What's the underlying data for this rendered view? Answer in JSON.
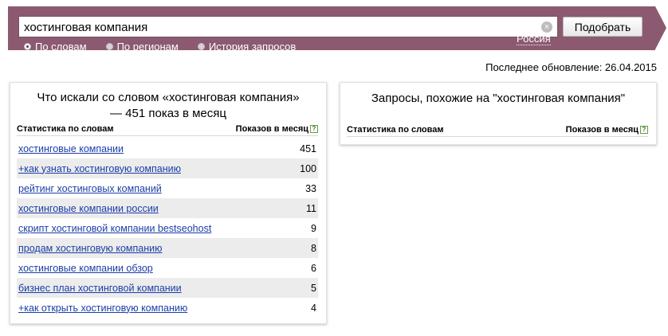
{
  "search": {
    "value": "хостинговая компания",
    "clear_glyph": "×",
    "submit_label": "Подобрать"
  },
  "modes": [
    {
      "label": "По словам",
      "checked": true
    },
    {
      "label": "По регионам",
      "checked": false
    },
    {
      "label": "История запросов",
      "checked": false
    }
  ],
  "region": "Россия",
  "last_update": "Последнее обновление: 26.04.2015",
  "left_panel": {
    "title": "Что искали со словом «хостинговая компания» — 451 показ в месяц",
    "col_words": "Статистика по словам",
    "col_impressions": "Показов в месяц",
    "help_glyph": "?",
    "rows": [
      {
        "phrase": "хостинговые компании",
        "count": "451"
      },
      {
        "phrase": "+как узнать хостинговую компанию",
        "count": "100"
      },
      {
        "phrase": "рейтинг хостинговых компаний",
        "count": "33"
      },
      {
        "phrase": "хостинговые компании россии",
        "count": "11"
      },
      {
        "phrase": "скрипт хостинговой компании bestseohost",
        "count": "9"
      },
      {
        "phrase": "продам хостинговую компанию",
        "count": "8"
      },
      {
        "phrase": "хостинговые компании обзор",
        "count": "6"
      },
      {
        "phrase": "бизнес план хостинговой компании",
        "count": "5"
      },
      {
        "phrase": "+как открыть хостинговую компанию",
        "count": "4"
      }
    ]
  },
  "right_panel": {
    "title": "Запросы, похожие на \"хостинговая компания\"",
    "col_words": "Статистика по словам",
    "col_impressions": "Показов в месяц",
    "help_glyph": "?"
  },
  "colors": {
    "header_bg": "#8b5a70",
    "link": "#1a3ea8",
    "row_alt": "#ececec"
  }
}
